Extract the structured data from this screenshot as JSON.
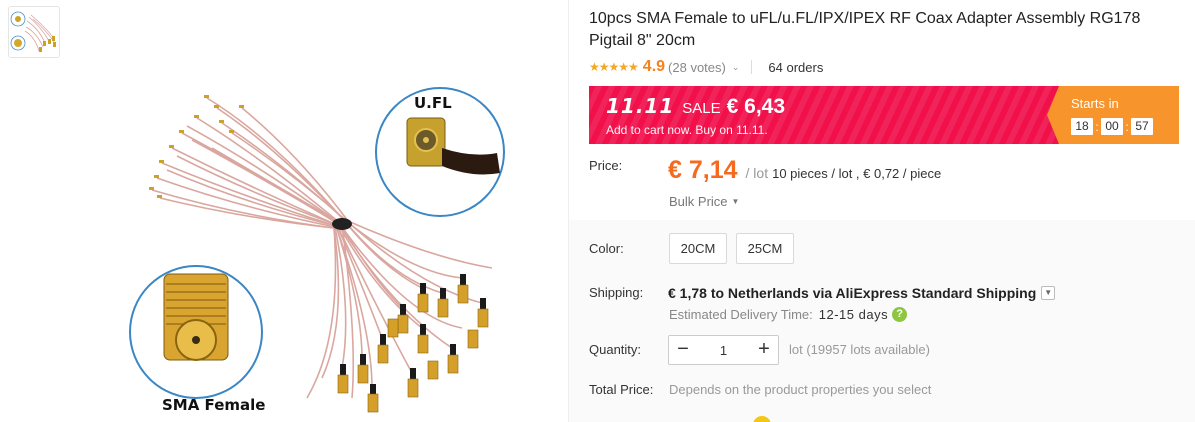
{
  "product": {
    "title": "10pcs SMA Female to uFL/u.FL/IPX/IPEX RF Coax Adapter Assembly RG178 Pigtail 8\" 20cm",
    "rating": {
      "stars": "★★★★★",
      "score": "4.9",
      "votes": "(28 votes)"
    },
    "orders": "64 orders"
  },
  "gallery": {
    "image_labels": {
      "top": "U.FL",
      "bottom": "SMA Female"
    }
  },
  "sale": {
    "brand": "11.11",
    "word": "SALE",
    "price": "€ 6,43",
    "subtitle": "Add to cart now. Buy on 11.11.",
    "starts_in": "Starts in",
    "timer": {
      "h": "18",
      "m": "00",
      "s": "57"
    },
    "colors": {
      "banner": "#f2104a",
      "countdown": "#f7942b"
    }
  },
  "price": {
    "label": "Price:",
    "value": "€ 7,14",
    "unit": "/ lot",
    "per_piece": "10 pieces / lot , € 0,72 / piece",
    "bulk": "Bulk Price",
    "color": "#f56a1f"
  },
  "color_option": {
    "label": "Color:",
    "options": [
      "20CM",
      "25CM"
    ]
  },
  "shipping": {
    "label": "Shipping:",
    "text": "€ 1,78 to Netherlands via AliExpress Standard Shipping",
    "delivery_label": "Estimated Delivery Time:",
    "delivery_days": "12-15 days"
  },
  "quantity": {
    "label": "Quantity:",
    "value": "1",
    "minus": "−",
    "plus": "+",
    "available": "lot (19957 lots available)"
  },
  "total": {
    "label": "Total Price:",
    "note": "Depends on the product properties you select"
  },
  "icons": {
    "dropdown": "chevron-down-icon",
    "help": "question-icon"
  }
}
